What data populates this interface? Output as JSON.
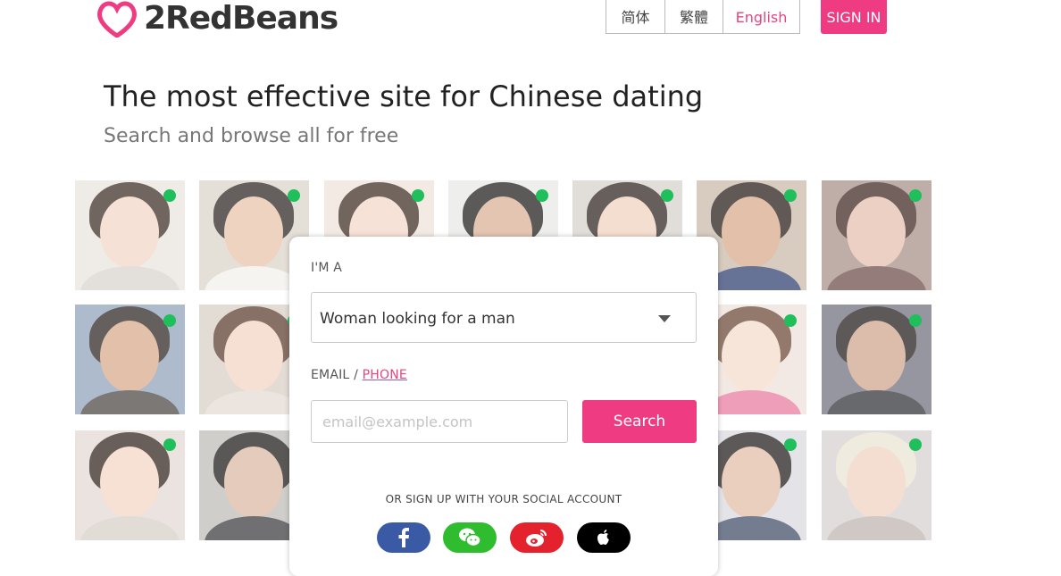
{
  "header": {
    "logo_text": "2RedBeans",
    "languages": [
      "简体",
      "繁體",
      "English"
    ],
    "active_language": "English",
    "signin_label": "SIGN IN"
  },
  "hero": {
    "title": "The most effective site for Chinese dating",
    "subtitle": "Search and browse all for free"
  },
  "signup": {
    "iam_label": "I'M A",
    "seeking_value": "Woman looking for a man",
    "email_label": "EMAIL /",
    "phone_link": "PHONE",
    "email_placeholder": "email@example.com",
    "search_label": "Search",
    "social_label": "OR SIGN UP WITH YOUR SOCIAL ACCOUNT",
    "social_icons": [
      "facebook-icon",
      "wechat-icon",
      "weibo-icon",
      "apple-icon"
    ]
  },
  "colors": {
    "brand_pink": "#ef3b81",
    "online_green": "#1fbf5c",
    "facebook": "#3b5aa6",
    "wechat": "#2fbd2f",
    "weibo": "#e3222e",
    "apple": "#000000"
  }
}
